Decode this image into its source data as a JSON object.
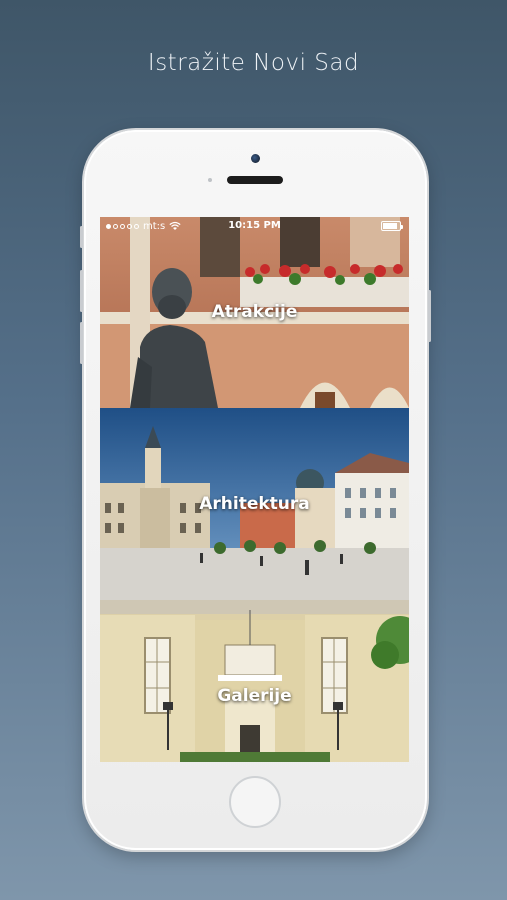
{
  "headline": "Istražite Novi Sad",
  "statusbar": {
    "carrier": "mt:s",
    "time": "10:15 PM",
    "signal_bars_filled": 1,
    "signal_bars_total": 5,
    "battery_level": 0.85
  },
  "tiles": [
    {
      "label": "Atrakcije"
    },
    {
      "label": "Arhitektura"
    },
    {
      "label": "Galerije"
    }
  ],
  "icons": [
    "wifi-icon",
    "battery-icon",
    "signal-icon"
  ],
  "colors": {
    "background_top": "#3f5668",
    "background_bottom": "#7f96ab",
    "phone_body": "#f2f2f2"
  }
}
